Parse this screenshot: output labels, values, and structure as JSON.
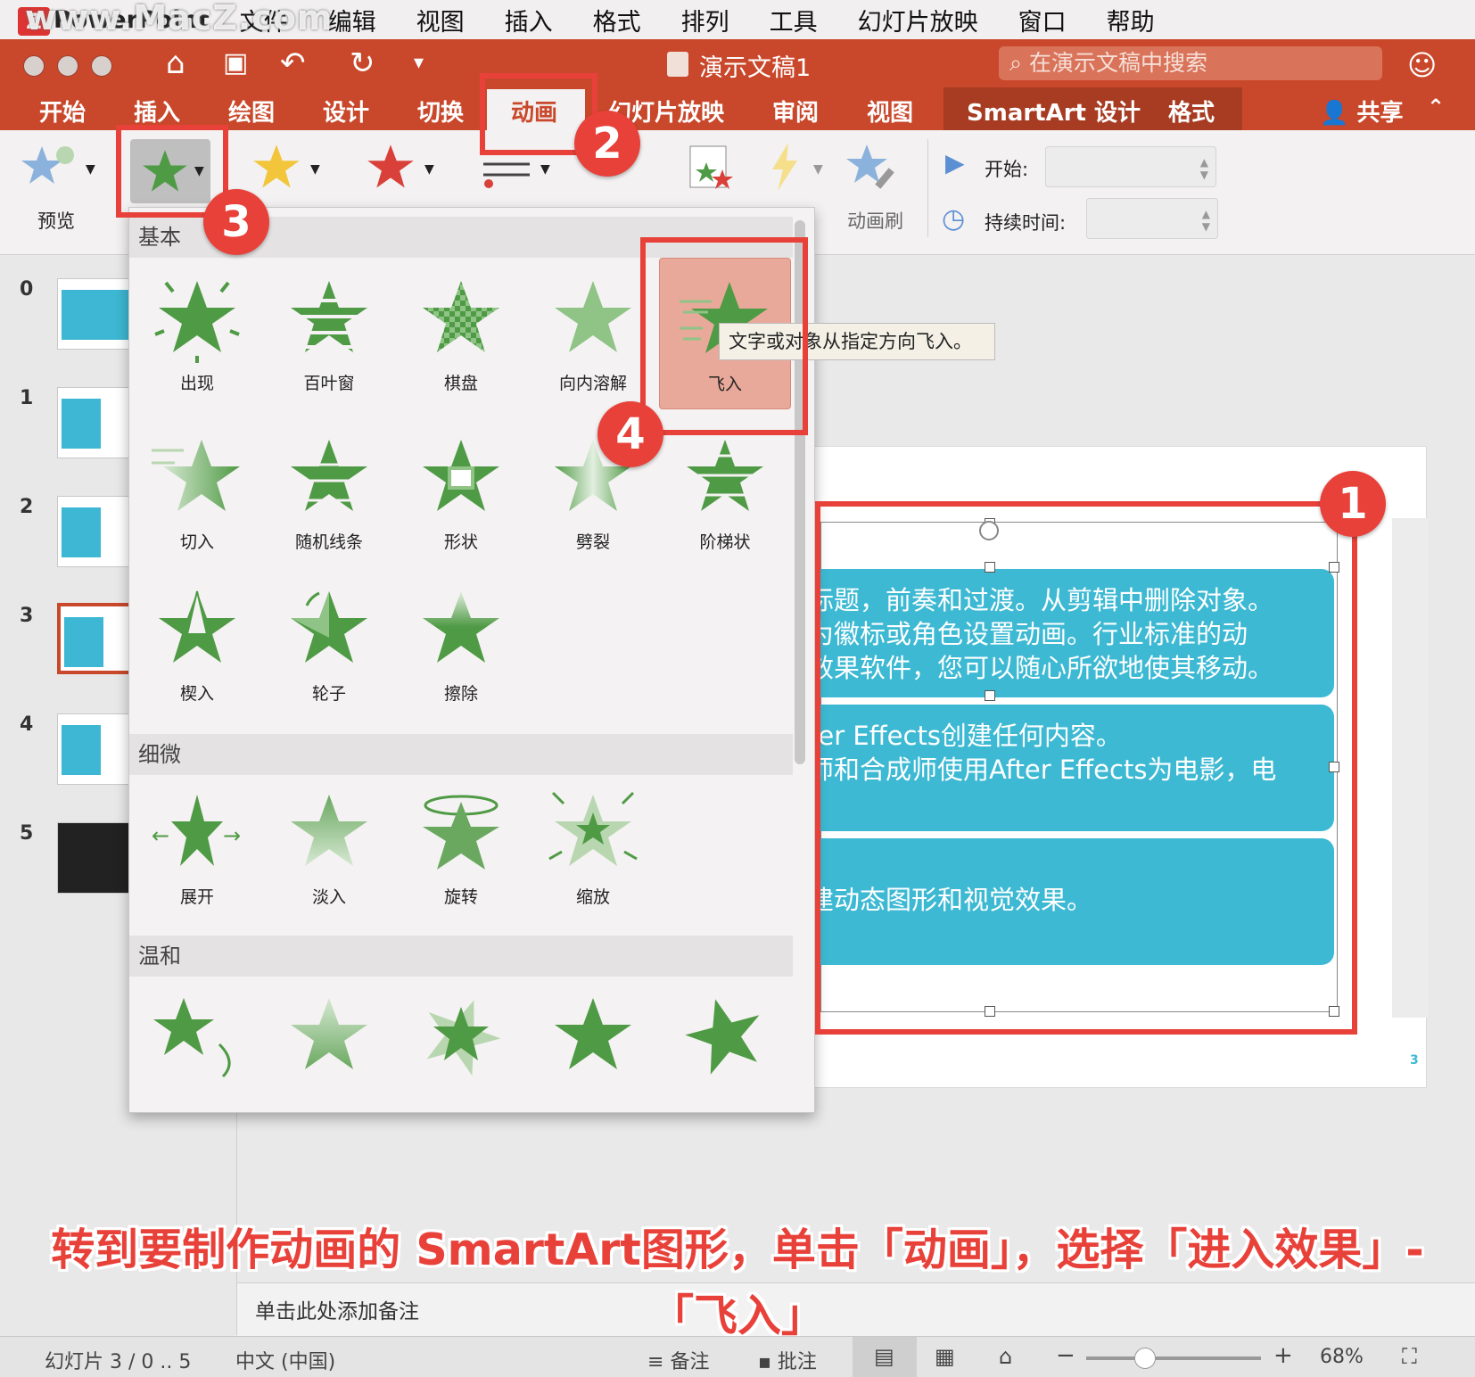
{
  "menubar": {
    "app": "PowerPoint",
    "watermark": "www.MacZ.com",
    "items": [
      "文件",
      "编辑",
      "视图",
      "插入",
      "格式",
      "排列",
      "工具",
      "幻灯片放映",
      "窗口",
      "帮助"
    ]
  },
  "titlebar": {
    "doc_title": "演示文稿1",
    "search_placeholder": "在演示文稿中搜索"
  },
  "tabs": {
    "items": [
      "开始",
      "插入",
      "绘图",
      "设计",
      "切换"
    ],
    "active": "动画",
    "items_after": [
      "幻灯片放映",
      "审阅",
      "视图"
    ],
    "contextual": [
      "SmartArt 设计",
      "格式"
    ],
    "share": "共享"
  },
  "ribbon": {
    "preview": "预览",
    "animation_painter": "动画刷",
    "start_label": "开始:",
    "duration_label": "持续时间:"
  },
  "gallery": {
    "sections": [
      "基本",
      "细微",
      "温和"
    ],
    "basic": [
      "出现",
      "百叶窗",
      "棋盘",
      "向内溶解",
      "飞入",
      "切入",
      "随机线条",
      "形状",
      "劈裂",
      "阶梯状",
      "楔入",
      "轮子",
      "擦除"
    ],
    "subtle": [
      "展开",
      "淡入",
      "旋转",
      "缩放"
    ],
    "tooltip": "文字或对象从指定方向飞入。"
  },
  "thumbnails": [
    "0",
    "1",
    "2",
    "3",
    "4",
    "5"
  ],
  "slide": {
    "box1_lines": [
      "标题，前奏和过渡。从剪辑中删除对象。",
      "为徽标或角色设置动画。行业标准的动",
      "效果软件，您可以随心所欲地使其移动。"
    ],
    "box2_lines": [
      "ter Effects创建任何内容。",
      "师和合成师使用After Effects为电影，电"
    ],
    "box3_lines": [
      "建动态图形和视觉效果。"
    ],
    "page_number": "3"
  },
  "badges": [
    "1",
    "2",
    "3",
    "4"
  ],
  "caption": {
    "line1": "转到要制作动画的 SmartArt图形，单击「动画」，选择「进入效果」-",
    "line2": "「飞入」"
  },
  "notes": {
    "placeholder": "单击此处添加备注"
  },
  "status": {
    "slide": "幻灯片 3 / 0 .. 5",
    "language": "中文 (中国)",
    "notes": "备注",
    "comments": "批注",
    "zoom": "68%"
  },
  "colors": {
    "accent": "#c9482b",
    "annotation": "#e8413a",
    "smartart": "#3db9d3",
    "star": "#4f9a45"
  }
}
